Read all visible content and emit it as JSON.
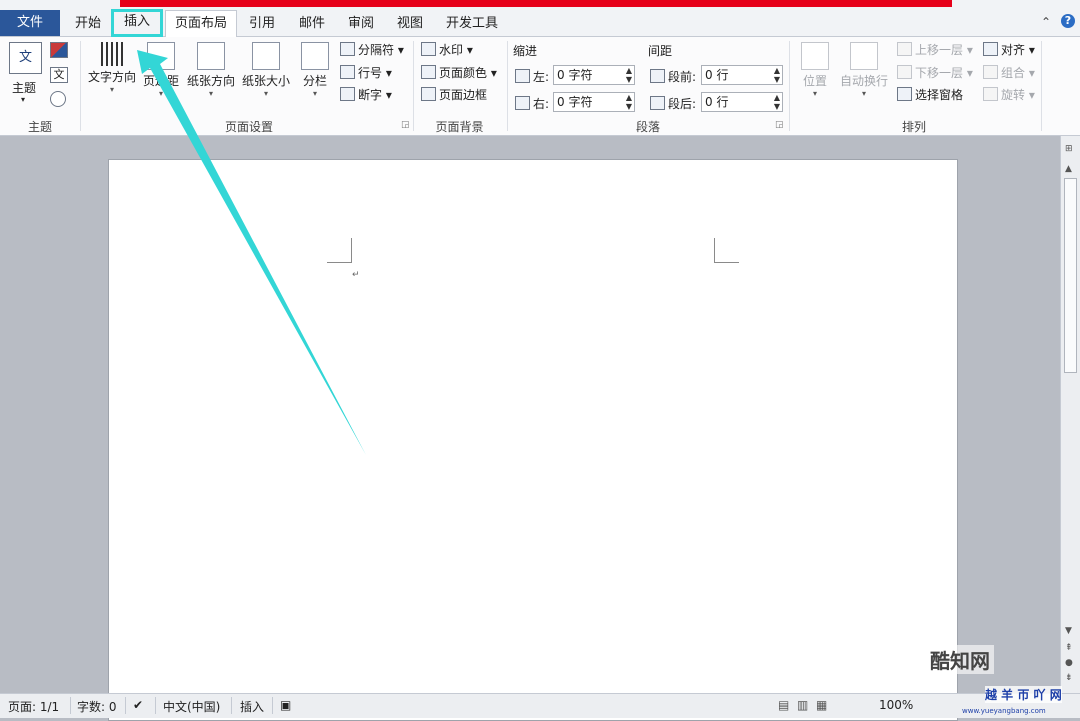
{
  "tabs": {
    "file": "文件",
    "home": "开始",
    "insert": "插入",
    "layout": "页面布局",
    "references": "引用",
    "mailings": "邮件",
    "review": "审阅",
    "view": "视图",
    "developer": "开发工具"
  },
  "help": "?",
  "ribbon": {
    "theme": {
      "button": "主题",
      "group": "主题",
      "glyph": "文",
      "mini_glyph": "文"
    },
    "page_setup": {
      "text_direction": "文字方向",
      "margins": "页边距",
      "orientation": "纸张方向",
      "size": "纸张大小",
      "columns": "分栏",
      "breaks": "分隔符",
      "line_numbers": "行号",
      "hyphenation": "断字",
      "group": "页面设置"
    },
    "page_background": {
      "watermark": "水印",
      "page_color": "页面颜色",
      "page_borders": "页面边框",
      "group": "页面背景"
    },
    "paragraph": {
      "indent_header": "缩进",
      "spacing_header": "间距",
      "left_label": "左:",
      "left_value": "0 字符",
      "right_label": "右:",
      "right_value": "0 字符",
      "before_label": "段前:",
      "before_value": "0 行",
      "after_label": "段后:",
      "after_value": "0 行",
      "group": "段落"
    },
    "arrange": {
      "position": "位置",
      "wrap_text": "自动换行",
      "bring_forward": "上移一层",
      "send_backward": "下移一层",
      "selection_pane": "选择窗格",
      "align": "对齐",
      "group_btn": "组合",
      "rotate": "旋转",
      "group": "排列"
    }
  },
  "status": {
    "page": "页面: 1/1",
    "words": "字数: 0",
    "language": "中文(中国)",
    "insert_mode": "插入",
    "zoom": "100%"
  },
  "watermarks": {
    "brand1": "酷知网",
    "brand2": "越 羊 帀 吖 网",
    "brand2_url": "www.yueyangbang.com"
  },
  "colors": {
    "accent": "#2b579a",
    "highlight": "#33d6d6",
    "red_bar": "#e6001a"
  }
}
